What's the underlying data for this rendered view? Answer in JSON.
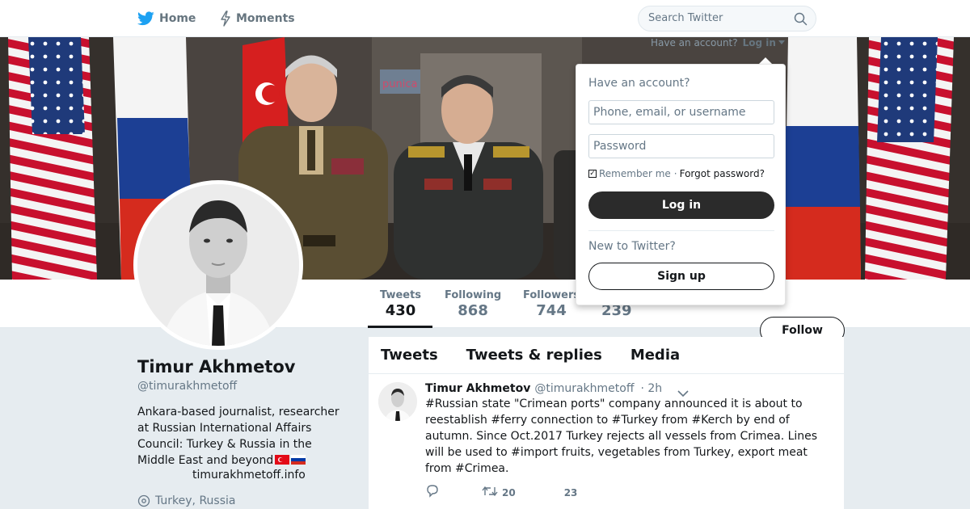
{
  "nav": {
    "home_label": "Home",
    "moments_label": "Moments",
    "search_placeholder": "Search Twitter"
  },
  "login_hint": {
    "text": "Have an account?",
    "link": "Log in"
  },
  "login_dropdown": {
    "title": "Have an account?",
    "username_placeholder": "Phone, email, or username",
    "password_placeholder": "Password",
    "remember_label": "Remember me",
    "separator": "·",
    "forgot_label": "Forgot password?",
    "login_label": "Log in",
    "new_label": "New to Twitter?",
    "signup_label": "Sign up"
  },
  "stats": [
    {
      "label": "Tweets",
      "value": "430",
      "active": true
    },
    {
      "label": "Following",
      "value": "868"
    },
    {
      "label": "Followers",
      "value": "744"
    },
    {
      "label": "",
      "value": "239"
    }
  ],
  "follow_label": "Follow",
  "profile": {
    "name": "Timur Akhmetov",
    "handle": "@timurakhmetoff",
    "bio": "Ankara-based journalist, researcher at Russian International Affairs Council: Turkey & Russia in the Middle East and beyond",
    "url": "timurakhmetoff.info",
    "location": "Turkey, Russia"
  },
  "timeline": {
    "tabs": [
      "Tweets",
      "Tweets & replies",
      "Media"
    ],
    "tweet": {
      "name": "Timur Akhmetov",
      "handle": "@timurakhmetoff",
      "time": "· 2h",
      "text": "#Russian state \"Crimean ports\" company announced it is about to reestablish #ferry connection to #Turkey from #Kerch by end of autumn. Since Oct.2017 Turkey rejects all vessels from Crimea. Lines will be used to #import fruits, vegetables from Turkey, export meat from #Crimea.",
      "retweets": "20",
      "likes": "23"
    }
  },
  "colors": {
    "twitter_blue": "#1da1f2",
    "text_dark": "#14171a",
    "text_gray": "#657786"
  }
}
